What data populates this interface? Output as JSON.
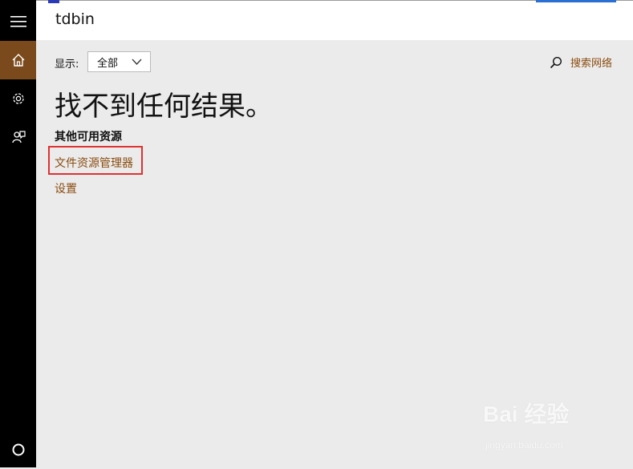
{
  "search": {
    "query": "tdbin"
  },
  "filter": {
    "label": "显示:",
    "selected": "全部"
  },
  "web_search": {
    "label": "搜索网络"
  },
  "results": {
    "empty_message": "找不到任何结果。",
    "other_heading": "其他可用资源",
    "links": [
      {
        "label": "文件资源管理器"
      },
      {
        "label": "设置"
      }
    ]
  },
  "rail": {
    "items": [
      "menu-icon",
      "home-icon",
      "settings-icon",
      "feedback-icon",
      "cortana-icon"
    ],
    "active_color": "#7a4a1c"
  },
  "watermark": {
    "brand": "Bai 经验",
    "url": "jingyan.baidu.com"
  },
  "colors": {
    "link": "#8a4b0f",
    "highlight_box": "#e03131",
    "background": "#ebebeb"
  }
}
